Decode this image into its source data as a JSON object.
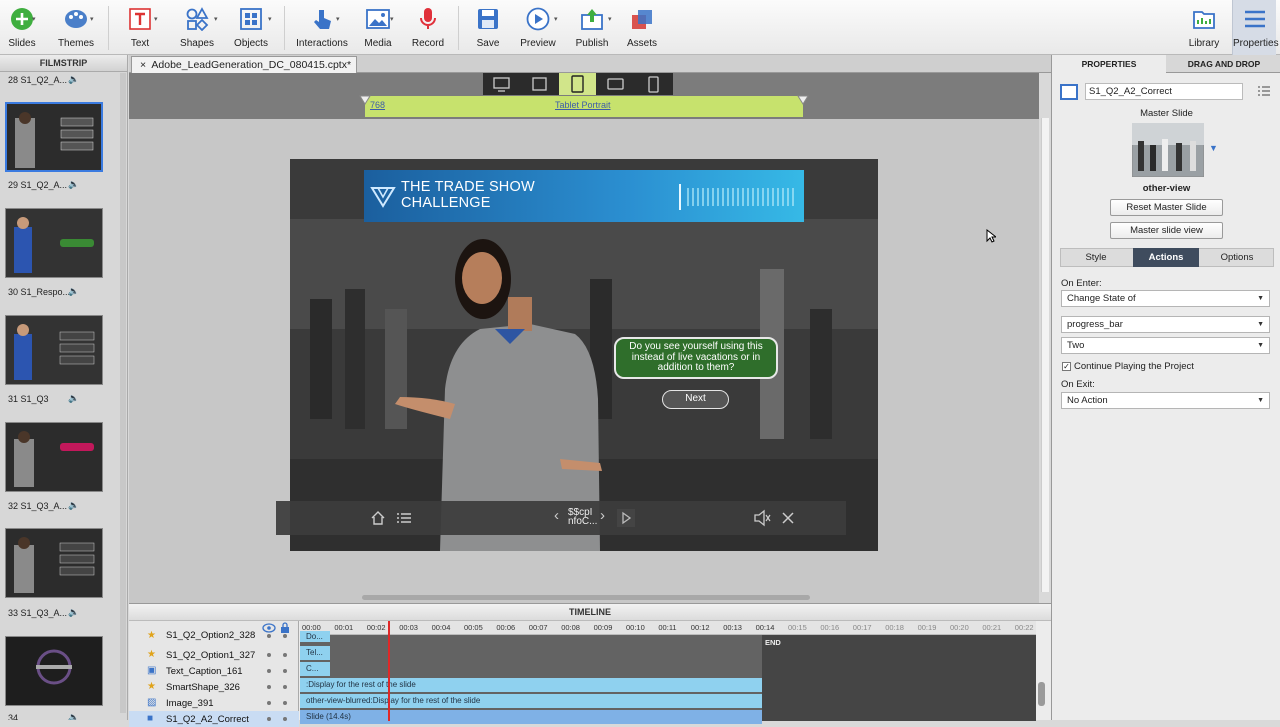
{
  "toolbar": {
    "buttons": [
      {
        "label": "Slides"
      },
      {
        "label": "Themes"
      },
      {
        "label": "Text"
      },
      {
        "label": "Shapes"
      },
      {
        "label": "Objects"
      },
      {
        "label": "Interactions"
      },
      {
        "label": "Media"
      },
      {
        "label": "Record"
      },
      {
        "label": "Save"
      },
      {
        "label": "Preview"
      },
      {
        "label": "Publish"
      },
      {
        "label": "Assets"
      },
      {
        "label": "Library"
      },
      {
        "label": "Properties"
      }
    ]
  },
  "filmstrip": {
    "title": "FILMSTRIP",
    "slides": [
      {
        "label": "28 S1_Q2_A..."
      },
      {
        "label": "29 S1_Q2_A..."
      },
      {
        "label": "30 S1_Respo..."
      },
      {
        "label": "31 S1_Q3"
      },
      {
        "label": "32 S1_Q3_A..."
      },
      {
        "label": "33 S1_Q3_A..."
      },
      {
        "label": "34"
      }
    ]
  },
  "document": {
    "tab_title": "Adobe_LeadGeneration_DC_080415.cptx*",
    "close_glyph": "×"
  },
  "stage": {
    "breakpoint_value": "768",
    "breakpoint_name": "Tablet Portrait",
    "slide": {
      "title_line1": "THE TRADE SHOW",
      "title_line2": "CHALLENGE",
      "question": "Do you see yourself using this instead of live vacations or in addition to them?",
      "next_label": "Next",
      "playbar_text": "$$cpI nfoC..."
    }
  },
  "timeline": {
    "title": "TIMELINE",
    "ruler": [
      "00:00",
      "00:01",
      "00:02",
      "00:03",
      "00:04",
      "00:05",
      "00:06",
      "00:07",
      "00:08",
      "00:09",
      "00:10",
      "00:11",
      "00:12",
      "00:13",
      "00:14",
      "00:15",
      "00:16",
      "00:17",
      "00:18",
      "00:19",
      "00:20",
      "00:21",
      "00:22"
    ],
    "end_label": "END",
    "rows": [
      {
        "name": "S1_Q2_Option2_328",
        "bar": "Do..."
      },
      {
        "name": "S1_Q2_Option1_327",
        "bar": "Tel..."
      },
      {
        "name": "Text_Caption_161",
        "bar": "C..."
      },
      {
        "name": "SmartShape_326",
        "bar": ":Display for the rest of the slide"
      },
      {
        "name": "Image_391",
        "bar": "other-view-blurred:Display for the rest of the slide"
      },
      {
        "name": "S1_Q2_A2_Correct",
        "bar": "Slide (14.4s)"
      }
    ]
  },
  "properties": {
    "tabs": [
      "PROPERTIES",
      "DRAG AND DROP"
    ],
    "object_name": "S1_Q2_A2_Correct",
    "master_slide_label": "Master Slide",
    "master_name": "other-view",
    "reset_master_label": "Reset Master Slide",
    "master_view_label": "Master slide view",
    "segments": [
      "Style",
      "Actions",
      "Options"
    ],
    "on_enter_label": "On Enter:",
    "on_enter_action": "Change State of",
    "target_object": "progress_bar",
    "target_state": "Two",
    "continue_label": "Continue Playing the Project",
    "continue_checked": "✓",
    "on_exit_label": "On Exit:",
    "on_exit_action": "No Action"
  }
}
